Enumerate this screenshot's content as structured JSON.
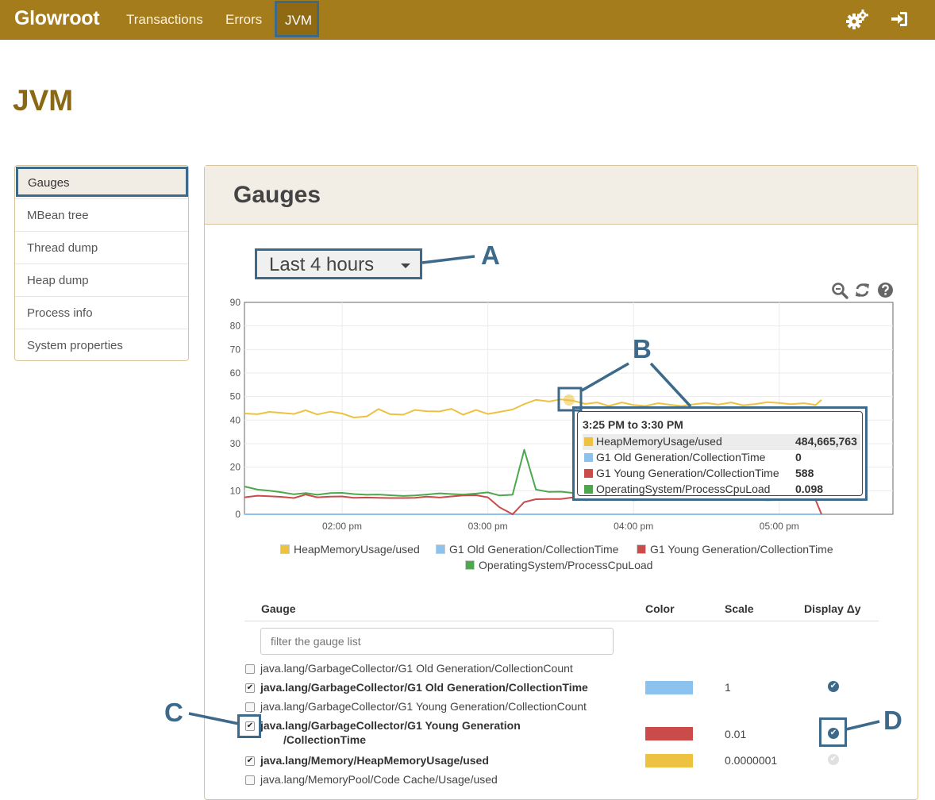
{
  "nav": {
    "brand": "Glowroot",
    "transactions": "Transactions",
    "errors": "Errors",
    "jvm": "JVM",
    "settings_icon": "gears-icon",
    "signin_icon": "sign-in-icon"
  },
  "page": {
    "title": "JVM"
  },
  "sidebar": {
    "items": [
      {
        "label": "Gauges",
        "active": true
      },
      {
        "label": "MBean tree"
      },
      {
        "label": "Thread dump"
      },
      {
        "label": "Heap dump"
      },
      {
        "label": "Process info"
      },
      {
        "label": "System properties"
      }
    ]
  },
  "panel": {
    "title": "Gauges",
    "time_range": "Last 4 hours",
    "toolbar_icons": [
      "zoom-out-icon",
      "refresh-icon",
      "help-icon"
    ]
  },
  "annotations": {
    "a": "A",
    "b": "B",
    "c": "C",
    "d": "D"
  },
  "chart_data": {
    "type": "line",
    "ylim": [
      0,
      90
    ],
    "yticks": [
      "0",
      "10",
      "20",
      "30",
      "40",
      "50",
      "60",
      "70",
      "80",
      "90"
    ],
    "xticks": [
      "02:00 pm",
      "03:00 pm",
      "04:00 pm",
      "05:00 pm"
    ],
    "xtick_hours": [
      14,
      15,
      16,
      17
    ],
    "xrange_hours": [
      13.33,
      17.78
    ],
    "grid": true,
    "legend_position": "bottom",
    "series": [
      {
        "name": "HeapMemoryUsage/used",
        "color": "#edc240",
        "x": [
          13.33,
          13.42,
          13.5,
          13.58,
          13.67,
          13.75,
          13.83,
          13.92,
          14.0,
          14.08,
          14.17,
          14.25,
          14.33,
          14.42,
          14.5,
          14.58,
          14.67,
          14.75,
          14.83,
          14.92,
          15.0,
          15.08,
          15.17,
          15.25,
          15.33,
          15.42,
          15.5,
          15.58,
          15.67,
          15.75,
          15.83,
          15.92,
          16.0,
          16.08,
          16.17,
          16.25,
          16.33,
          16.42,
          16.5,
          16.58,
          16.67,
          16.75,
          16.83,
          16.92,
          17.0,
          17.08,
          17.17,
          17.25,
          17.29
        ],
        "y": [
          42.8,
          42.5,
          43.5,
          43.1,
          42.6,
          44.2,
          42.4,
          43.6,
          42.8,
          41.1,
          41.6,
          44.7,
          42.5,
          42.3,
          44.3,
          43.8,
          43.7,
          44.8,
          42.3,
          44.3,
          42.6,
          43.5,
          44.5,
          46.8,
          48.6,
          47.9,
          48.8,
          48.3,
          46.9,
          47.5,
          46.0,
          47.5,
          46.4,
          46.0,
          47.2,
          46.5,
          46.0,
          46.8,
          47.3,
          46.6,
          47.5,
          46.3,
          46.8,
          47.6,
          47.3,
          46.8,
          47.2,
          46.4,
          48.6
        ]
      },
      {
        "name": "G1 Old Generation/CollectionTime",
        "color": "#8cc3ee",
        "x": [
          13.33,
          17.29
        ],
        "y": [
          0,
          0
        ]
      },
      {
        "name": "G1 Young Generation/CollectionTime",
        "color": "#cb4b4b",
        "x": [
          13.33,
          13.42,
          13.5,
          13.58,
          13.67,
          13.75,
          13.83,
          13.92,
          14.0,
          14.08,
          14.17,
          14.25,
          14.33,
          14.42,
          14.5,
          14.58,
          14.67,
          14.75,
          14.83,
          14.92,
          15.0,
          15.08,
          15.17,
          15.25,
          15.33,
          15.42,
          15.5,
          15.58,
          15.67,
          15.75,
          15.83,
          15.92,
          16.0,
          16.08,
          16.17,
          16.25,
          16.33,
          16.42,
          16.5,
          16.58,
          16.67,
          16.75,
          16.83,
          16.92,
          17.0,
          17.08,
          17.17,
          17.25,
          17.29
        ],
        "y": [
          7.2,
          7.9,
          7.7,
          7.4,
          6.9,
          8.4,
          7.2,
          7.5,
          7.6,
          7.0,
          7.1,
          7.0,
          6.9,
          6.9,
          7.0,
          7.5,
          7.1,
          7.6,
          8.0,
          8.1,
          7.2,
          3.0,
          0.0,
          5.2,
          6.4,
          6.5,
          6.5,
          7.1,
          6.0,
          6.3,
          6.6,
          6.4,
          6.0,
          6.3,
          6.5,
          6.9,
          6.1,
          6.6,
          6.3,
          6.2,
          6.5,
          6.5,
          6.2,
          6.0,
          6.1,
          6.1,
          6.3,
          6.0,
          0.0
        ]
      },
      {
        "name": "OperatingSystem/ProcessCpuLoad",
        "color": "#4da74d",
        "x": [
          13.33,
          13.42,
          13.5,
          13.58,
          13.67,
          13.75,
          13.83,
          13.92,
          14.0,
          14.08,
          14.17,
          14.25,
          14.33,
          14.42,
          14.5,
          14.58,
          14.67,
          14.75,
          14.83,
          14.92,
          15.0,
          15.08,
          15.17,
          15.25,
          15.33,
          15.42,
          15.5,
          15.58,
          15.67,
          15.75,
          15.83,
          15.92,
          16.0,
          16.08,
          16.17,
          16.25,
          16.33,
          16.42,
          16.5,
          16.58,
          16.67,
          16.75,
          16.83,
          16.92,
          17.0,
          17.08,
          17.17,
          17.25,
          17.29
        ],
        "y": [
          11.8,
          10.5,
          10.0,
          9.4,
          8.5,
          9.0,
          8.3,
          9.0,
          9.1,
          8.6,
          8.3,
          8.4,
          8.1,
          7.8,
          8.0,
          8.4,
          8.9,
          8.6,
          8.4,
          8.8,
          9.3,
          8.0,
          8.3,
          27.4,
          10.5,
          9.5,
          9.6,
          9.1,
          8.9,
          9.3,
          8.7,
          9.0,
          9.1,
          8.8,
          9.0,
          8.6,
          8.9,
          9.1,
          8.8,
          8.7,
          9.0,
          8.9,
          9.2,
          8.8,
          8.9,
          8.7,
          9.0,
          8.8,
          8.9
        ]
      }
    ]
  },
  "tooltip": {
    "title": "3:25 PM to 3:30 PM",
    "rows": [
      {
        "name": "HeapMemoryUsage/used",
        "value": "484,665,763",
        "color": "#edc240"
      },
      {
        "name": "G1 Old Generation/CollectionTime",
        "value": "0",
        "color": "#8cc3ee"
      },
      {
        "name": "G1 Young Generation/CollectionTime",
        "value": "588",
        "color": "#cb4b4b"
      },
      {
        "name": "OperatingSystem/ProcessCpuLoad",
        "value": "0.098",
        "color": "#4da74d"
      }
    ]
  },
  "gauge_table": {
    "headers": {
      "gauge": "Gauge",
      "color": "Color",
      "scale": "Scale",
      "display": "Display Δy"
    },
    "filter_placeholder": "filter the gauge list",
    "rows": [
      {
        "name": "java.lang/GarbageCollector/G1 Old Generation/CollectionCount",
        "checked": false
      },
      {
        "name": "java.lang/GarbageCollector/G1 Old Generation/CollectionTime",
        "checked": true,
        "color": "#8cc3ee",
        "scale": "1",
        "display_dy": true
      },
      {
        "name": "java.lang/GarbageCollector/G1 Young Generation/CollectionCount",
        "checked": false
      },
      {
        "name_line1": "java.lang/GarbageCollector/G1 Young Generation",
        "name_line2": "/CollectionTime",
        "checked": true,
        "color": "#cb4b4b",
        "scale": "0.01",
        "display_dy": true
      },
      {
        "name": "java.lang/Memory/HeapMemoryUsage/used",
        "checked": true,
        "color": "#edc240",
        "scale": "0.0000001",
        "display_dy": false
      },
      {
        "name": "java.lang/MemoryPool/Code Cache/Usage/used",
        "checked": false
      }
    ]
  }
}
